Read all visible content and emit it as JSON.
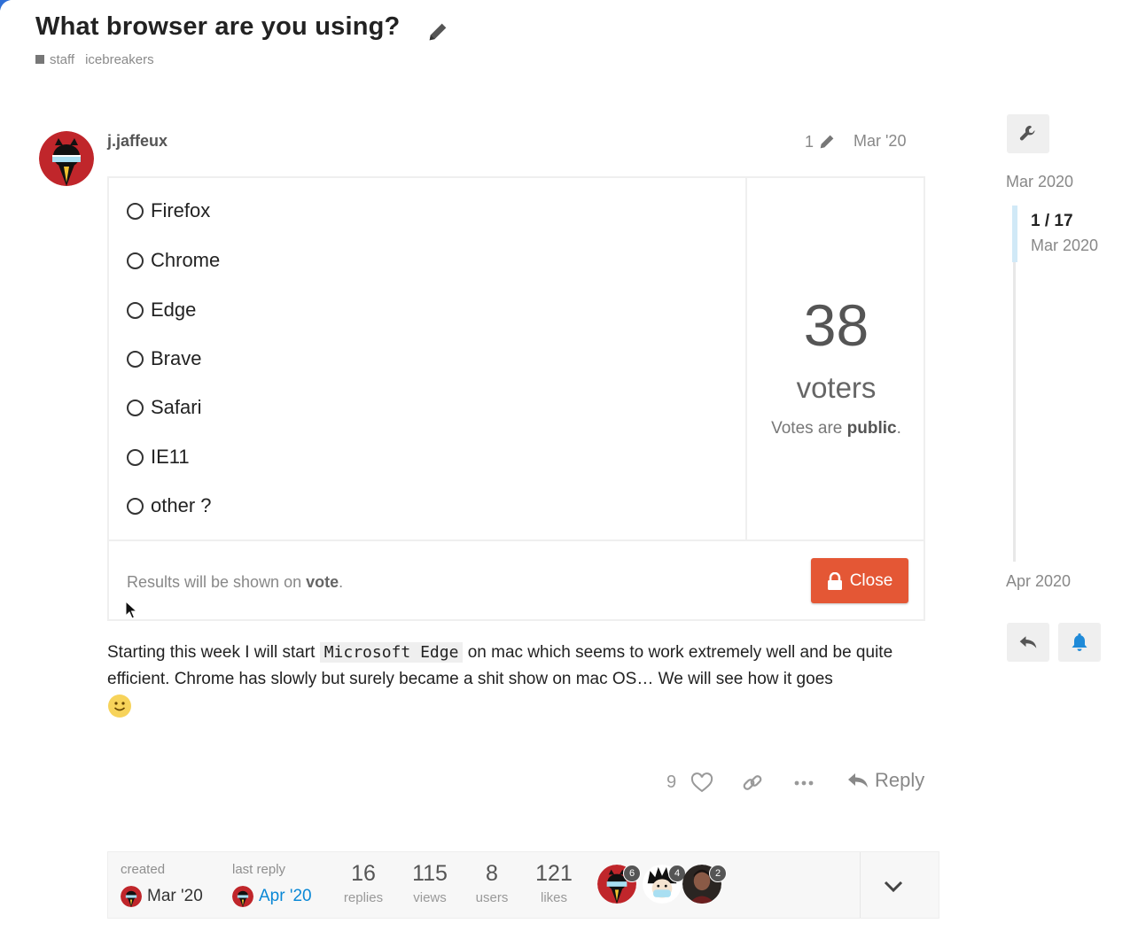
{
  "topic": {
    "title": "What browser are you using?",
    "category": "staff",
    "tag": "icebreakers"
  },
  "post": {
    "username": "j.jaffeux",
    "edit_count": "1",
    "date": "Mar '20",
    "body_before_code": "Starting this week I will start ",
    "body_code": "Microsoft Edge",
    "body_after_code": " on mac which seems to work extremely well and be quite efficient. Chrome has slowly but surely became a shit show on mac OS… We will see how it goes",
    "emoji": "slightly-smiling-face"
  },
  "poll": {
    "options": [
      "Firefox",
      "Chrome",
      "Edge",
      "Brave",
      "Safari",
      "IE11",
      "other ?"
    ],
    "voters_count": "38",
    "voters_label": "voters",
    "votes_public_prefix": "Votes are ",
    "votes_public_strong": "public",
    "votes_public_suffix": ".",
    "results_prefix": "Results will be shown on ",
    "results_strong": "vote",
    "results_suffix": ".",
    "close_label": "Close"
  },
  "actions": {
    "like_count": "9",
    "reply_label": "Reply"
  },
  "topic_map": {
    "created_label": "created",
    "created_date": "Mar '20",
    "last_reply_label": "last reply",
    "last_reply_date": "Apr '20",
    "stats": [
      {
        "value": "16",
        "label": "replies"
      },
      {
        "value": "115",
        "label": "views"
      },
      {
        "value": "8",
        "label": "users"
      },
      {
        "value": "121",
        "label": "likes"
      }
    ],
    "participants": [
      {
        "avatar": "masked-cat-avatar",
        "count": "6"
      },
      {
        "avatar": "spiky-hair-avatar",
        "count": "4"
      },
      {
        "avatar": "photo-avatar",
        "count": "2"
      }
    ]
  },
  "timeline": {
    "start_date": "Mar 2020",
    "position": "1 / 17",
    "position_date": "Mar 2020",
    "end_date": "Apr 2020"
  },
  "colors": {
    "close_button": "#e45735",
    "link_date": "#0a88d6",
    "avatar_red": "#c0262b",
    "timeline_handle": "#d1e9f7",
    "bell": "#1f8ad8"
  }
}
